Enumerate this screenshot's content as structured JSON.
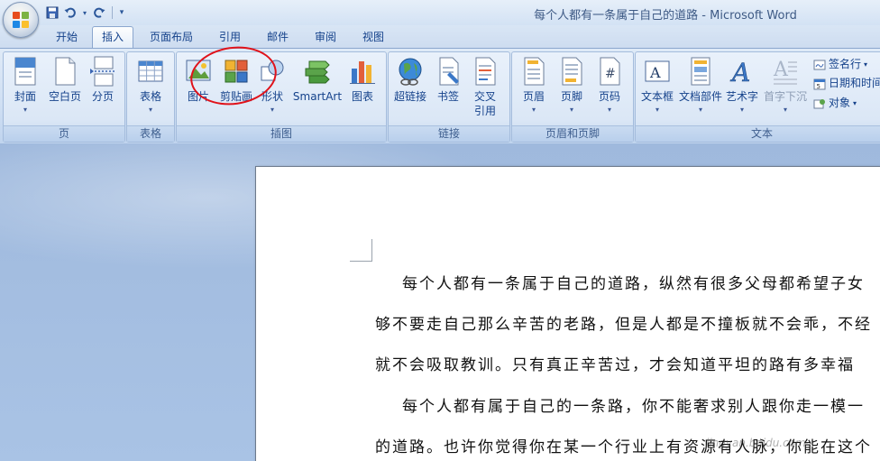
{
  "window": {
    "title": "每个人都有一条属于自己的道路 - Microsoft Word"
  },
  "tabs": [
    {
      "label": "开始"
    },
    {
      "label": "插入"
    },
    {
      "label": "页面布局"
    },
    {
      "label": "引用"
    },
    {
      "label": "邮件"
    },
    {
      "label": "审阅"
    },
    {
      "label": "视图"
    }
  ],
  "ribbon": {
    "groups": {
      "page": {
        "label": "页",
        "buttons": [
          "封面",
          "空白页",
          "分页"
        ]
      },
      "table": {
        "label": "表格",
        "buttons": [
          "表格"
        ]
      },
      "illustrations": {
        "label": "插图",
        "buttons": [
          "图片",
          "剪贴画",
          "形状",
          "SmartArt",
          "图表"
        ]
      },
      "links": {
        "label": "链接",
        "buttons": [
          "超链接",
          "书签",
          "交叉",
          "引用"
        ]
      },
      "header_footer": {
        "label": "页眉和页脚",
        "buttons": [
          "页眉",
          "页脚",
          "页码"
        ]
      },
      "text": {
        "label": "文本",
        "buttons": [
          "文本框",
          "文档部件",
          "艺术字",
          "首字下沉"
        ],
        "small": [
          "签名行",
          "日期和时间",
          "对象"
        ]
      }
    }
  },
  "document": {
    "lines": [
      "每个人都有一条属于自己的道路，纵然有很多父母都希望子女",
      "够不要走自己那么辛苦的老路，但是人都是不撞板就不会乖，不经",
      "就不会吸取教训。只有真正辛苦过，才会知道平坦的路有多幸福",
      "每个人都有属于自己的一条路，你不能奢求别人跟你走一模一",
      "的道路。也许你觉得你在某一个行业上有资源有人脉，你能在这个"
    ]
  },
  "watermark": {
    "text": "jingyan.baidu.com"
  }
}
